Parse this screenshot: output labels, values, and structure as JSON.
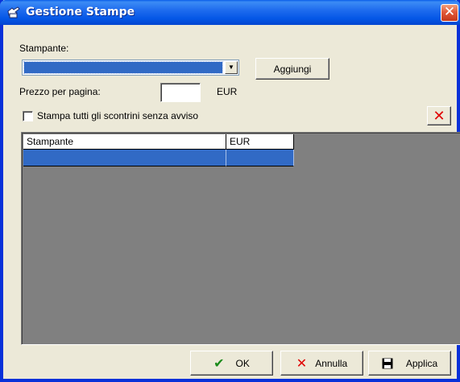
{
  "window": {
    "title": "Gestione Stampe",
    "close_glyph": "✕"
  },
  "icons": {
    "app": "hand-printer-icon",
    "close": "close-icon",
    "delete": "red-x-icon",
    "ok": "check-icon",
    "annulla": "red-x-icon",
    "applica": "floppy-disk-icon"
  },
  "printer": {
    "label": "Stampante:",
    "selected_value": ""
  },
  "add_button_label": "Aggiungi",
  "price": {
    "label": "Prezzo per pagina:",
    "value": "",
    "unit": "EUR"
  },
  "print_all": {
    "label": "Stampa tutti gli scontrini senza avviso",
    "checked": false
  },
  "delete_button_glyph": "✕",
  "table": {
    "columns": [
      "Stampante",
      "EUR"
    ],
    "rows": [
      [
        "",
        ""
      ]
    ]
  },
  "footer": {
    "ok_label": "OK",
    "ok_glyph": "✔",
    "annulla_label": "Annulla",
    "annulla_glyph": "✕",
    "applica_label": "Applica"
  },
  "colors": {
    "title_bar": "#0a5ee8",
    "selection": "#316ac5",
    "grid_background": "#808080",
    "face": "#ece9d8",
    "accent_red": "#e00000",
    "check_green": "#1a8a1a"
  }
}
